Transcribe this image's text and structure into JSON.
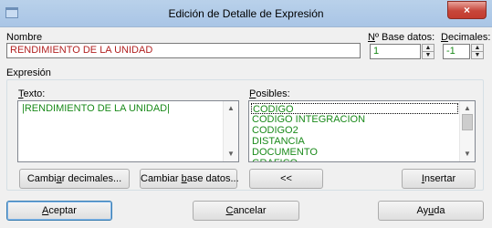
{
  "window": {
    "title": "Edición de Detalle de Expresión",
    "close_label": "×"
  },
  "nombre": {
    "label": "Nombre",
    "value": "RENDIMIENTO DE LA UNIDAD"
  },
  "base_datos": {
    "label_pre": "N",
    "label_rest": "º Base datos:",
    "value": "1"
  },
  "decimales": {
    "label_pre": "D",
    "label_rest": "ecimales:",
    "value": "-1"
  },
  "expresion": {
    "group_label": "Expresión",
    "texto_label_pre": "T",
    "texto_label_rest": "exto:",
    "texto_value": "|RENDIMIENTO DE LA UNIDAD|",
    "posibles_label_pre": "P",
    "posibles_label_rest": "osibles:",
    "posibles_items": [
      "CODIGO",
      "CODIGO INTEGRACION",
      "CODIGO2",
      "DISTANCIA",
      "DOCUMENTO",
      "GRAFICO"
    ]
  },
  "buttons": {
    "cambiar_decimales": {
      "pre": "Cambi",
      "u": "a",
      "post": "r decimales..."
    },
    "cambiar_base": {
      "pre": "Cambiar ",
      "u": "b",
      "post": "ase datos..."
    },
    "move_left": "<<",
    "insertar": {
      "u": "I",
      "post": "nsertar"
    },
    "aceptar": {
      "u": "A",
      "post": "ceptar"
    },
    "cancelar": {
      "u": "C",
      "post": "ancelar"
    },
    "ayuda": {
      "pre": "Ay",
      "u": "u",
      "post": "da"
    }
  }
}
